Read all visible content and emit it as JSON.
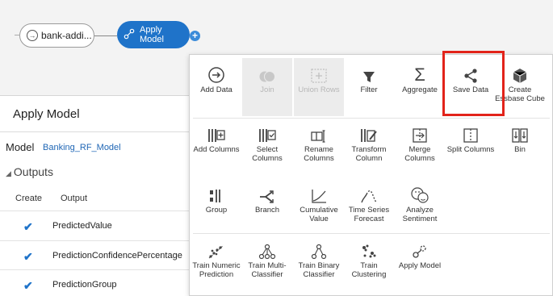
{
  "flow": {
    "source_node_label": "bank-addi...",
    "apply_node_label_line1": "Apply",
    "apply_node_label_line2": "Model",
    "add_step_symbol": "+"
  },
  "panel": {
    "title": "Apply Model",
    "model_label": "Model",
    "model_value": "Banking_RF_Model",
    "outputs_label": "Outputs",
    "columns": {
      "create": "Create",
      "output": "Output"
    },
    "rows": [
      {
        "name": "PredictedValue",
        "checked": true
      },
      {
        "name": "PredictionConfidencePercentage",
        "checked": true
      },
      {
        "name": "PredictionGroup",
        "checked": true
      }
    ]
  },
  "menu": {
    "row1": [
      {
        "label": "Add Data",
        "icon": "add-data-icon"
      },
      {
        "label": "Join",
        "icon": "join-icon",
        "disabled": true
      },
      {
        "label": "Union Rows",
        "icon": "union-rows-icon",
        "disabled": true
      },
      {
        "label": "Filter",
        "icon": "filter-icon"
      },
      {
        "label": "Aggregate",
        "icon": "aggregate-icon"
      },
      {
        "label": "Save Data",
        "icon": "share-icon"
      },
      {
        "label": "Create Essbase Cube",
        "icon": "cube-icon"
      }
    ],
    "row2": [
      {
        "label": "Add Columns",
        "icon": "add-columns-icon"
      },
      {
        "label": "Select Columns",
        "icon": "select-columns-icon"
      },
      {
        "label": "Rename Columns",
        "icon": "rename-columns-icon"
      },
      {
        "label": "Transform Column",
        "icon": "transform-column-icon"
      },
      {
        "label": "Merge Columns",
        "icon": "merge-columns-icon"
      },
      {
        "label": "Split Columns",
        "icon": "split-columns-icon"
      },
      {
        "label": "Bin",
        "icon": "bin-icon"
      }
    ],
    "row3": [
      {
        "label": "Group",
        "icon": "group-icon"
      },
      {
        "label": "Branch",
        "icon": "branch-icon"
      },
      {
        "label": "Cumulative Value",
        "icon": "cumulative-value-icon"
      },
      {
        "label": "Time Series Forecast",
        "icon": "time-series-icon"
      },
      {
        "label": "Analyze Sentiment",
        "icon": "sentiment-icon"
      }
    ],
    "row4": [
      {
        "label": "Train Numeric Prediction",
        "icon": "numeric-prediction-icon"
      },
      {
        "label": "Train Multi-Classifier",
        "icon": "multi-classifier-icon"
      },
      {
        "label": "Train Binary Classifier",
        "icon": "binary-classifier-icon"
      },
      {
        "label": "Train Clustering",
        "icon": "clustering-icon"
      },
      {
        "label": "Apply Model",
        "icon": "apply-model-icon"
      }
    ],
    "highlight_color": "#e2231a"
  },
  "colors": {
    "accent": "#1f73c9",
    "link": "#1f66b5"
  }
}
